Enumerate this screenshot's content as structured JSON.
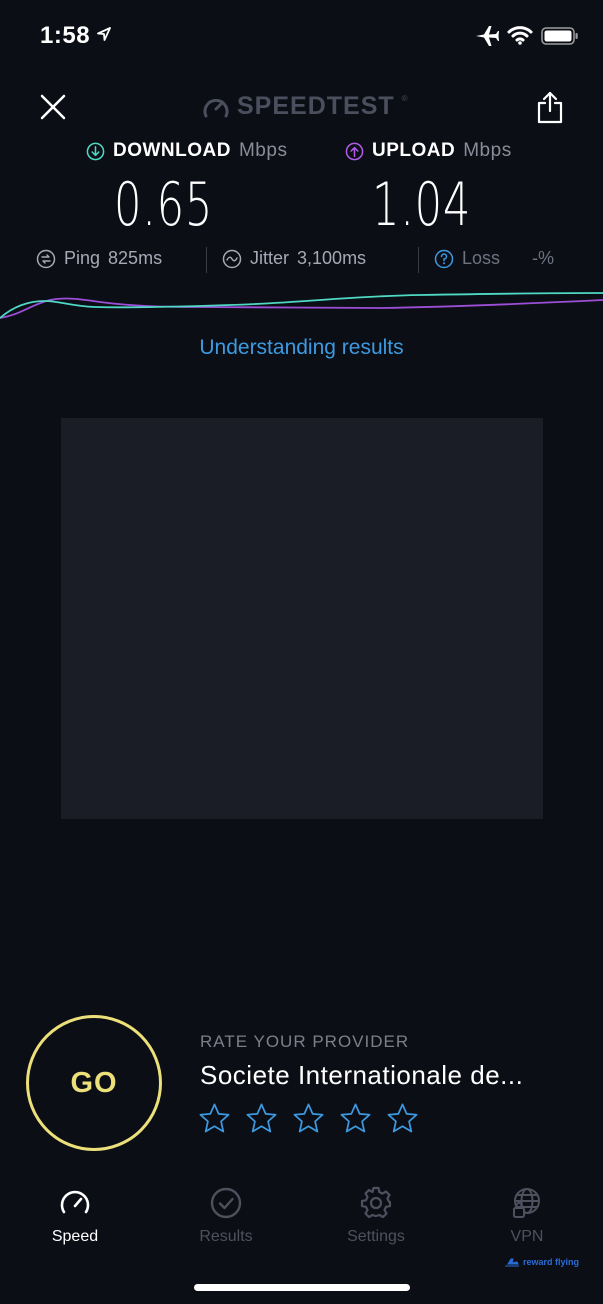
{
  "status_bar": {
    "time": "1:58",
    "icons": [
      "location-arrow-icon",
      "airplane-icon",
      "wifi-icon",
      "battery-icon"
    ]
  },
  "header": {
    "logo_text": "SPEEDTEST",
    "logo_tm": "®",
    "close_icon": "close-icon",
    "share_icon": "share-icon"
  },
  "metrics": {
    "download": {
      "label": "DOWNLOAD",
      "unit": "Mbps",
      "value": "0.65",
      "color": "#4fd8c4"
    },
    "upload": {
      "label": "UPLOAD",
      "unit": "Mbps",
      "value": "1.04",
      "color": "#b05ce8"
    }
  },
  "stats": {
    "ping": {
      "label": "Ping",
      "value": "825",
      "unit": "ms"
    },
    "jitter": {
      "label": "Jitter",
      "value": "3,100",
      "unit": "ms"
    },
    "loss": {
      "label": "Loss",
      "value": "-",
      "unit": "%"
    }
  },
  "understanding_link": "Understanding results",
  "go_button": {
    "label": "GO",
    "color": "#ece07a"
  },
  "rating": {
    "title": "RATE YOUR PROVIDER",
    "provider": "Societe Internationale de...",
    "stars_total": 5,
    "stars_selected": 0,
    "star_color": "#3d9ae0"
  },
  "tabs": [
    {
      "label": "Speed",
      "icon": "speedometer-icon",
      "active": true
    },
    {
      "label": "Results",
      "icon": "check-circle-icon",
      "active": false
    },
    {
      "label": "Settings",
      "icon": "gear-icon",
      "active": false
    },
    {
      "label": "VPN",
      "icon": "globe-lock-icon",
      "active": false
    }
  ],
  "watermark": "reward flying",
  "colors": {
    "background": "#0c0e16",
    "accent_blue": "#3d9ae0"
  }
}
